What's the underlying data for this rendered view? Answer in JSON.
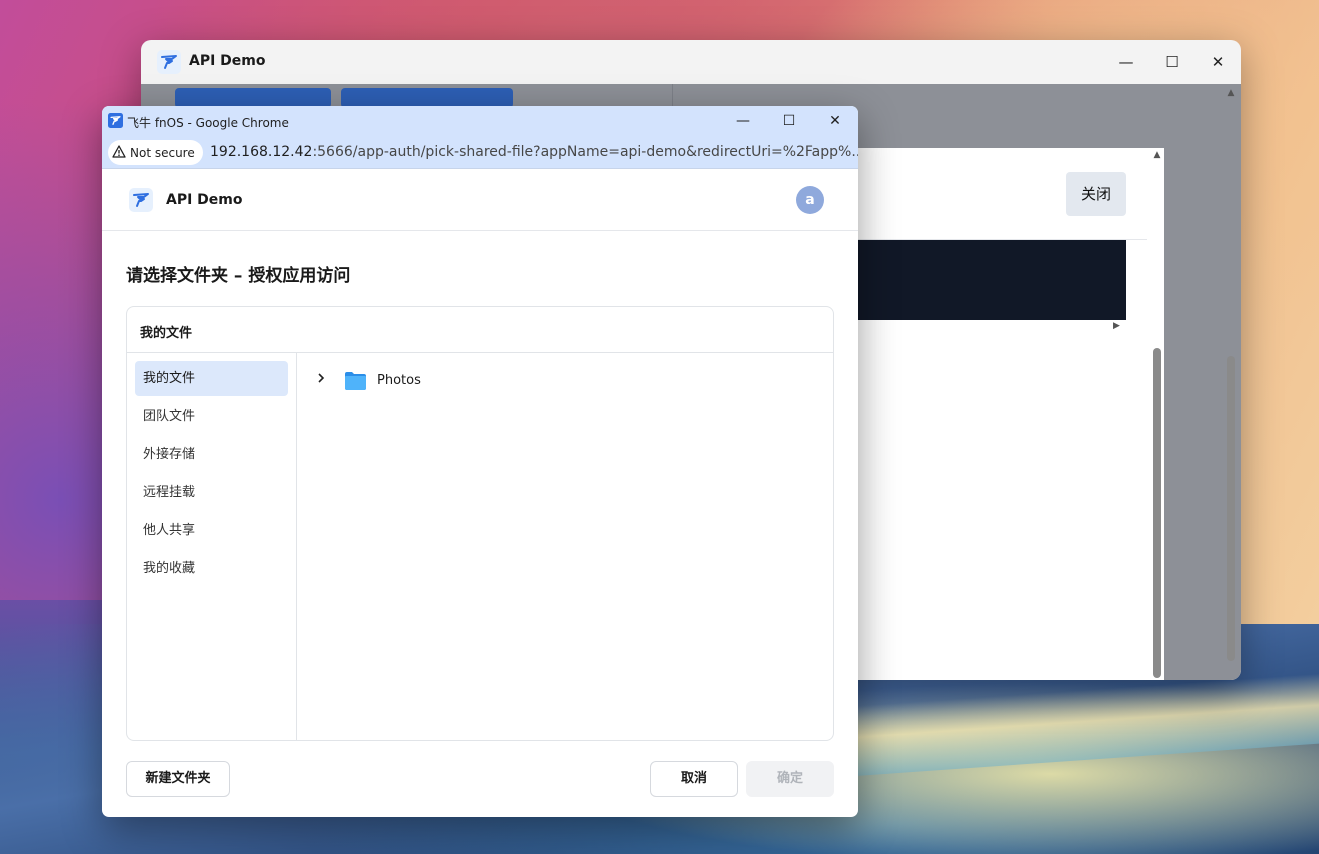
{
  "colors": {
    "accent": "#2d5fb5",
    "chrome_frame": "#d3e3fd",
    "selected_item_bg": "#dce8fb",
    "avatar_bg": "#8fa9dc",
    "folder_blue": "#3aa4f5"
  },
  "bg_window": {
    "title": "API Demo",
    "icon": "fnos-logo-icon",
    "controls": {
      "minimize": "—",
      "maximize": "☐",
      "close": "✕"
    },
    "panel": {
      "close_label": "关闭"
    }
  },
  "chrome": {
    "window_title": "飞牛 fnOS - Google Chrome",
    "security_label": "Not secure",
    "url_host": "192.168.12.42",
    "url_rest": ":5666/app-auth/pick-shared-file?appName=api-demo&redirectUri=%2Fapp%..."
  },
  "app": {
    "title": "API Demo",
    "avatar_letter": "a",
    "heading": "请选择文件夹 – 授权应用访问"
  },
  "picker": {
    "header": "我的文件",
    "sidebar": [
      {
        "label": "我的文件",
        "active": true
      },
      {
        "label": "团队文件",
        "active": false
      },
      {
        "label": "外接存储",
        "active": false
      },
      {
        "label": "远程挂载",
        "active": false
      },
      {
        "label": "他人共享",
        "active": false
      },
      {
        "label": "我的收藏",
        "active": false
      }
    ],
    "items": [
      {
        "name": "Photos",
        "type": "folder",
        "expandable": true
      }
    ]
  },
  "footer": {
    "new_folder": "新建文件夹",
    "cancel": "取消",
    "confirm": "确定"
  }
}
